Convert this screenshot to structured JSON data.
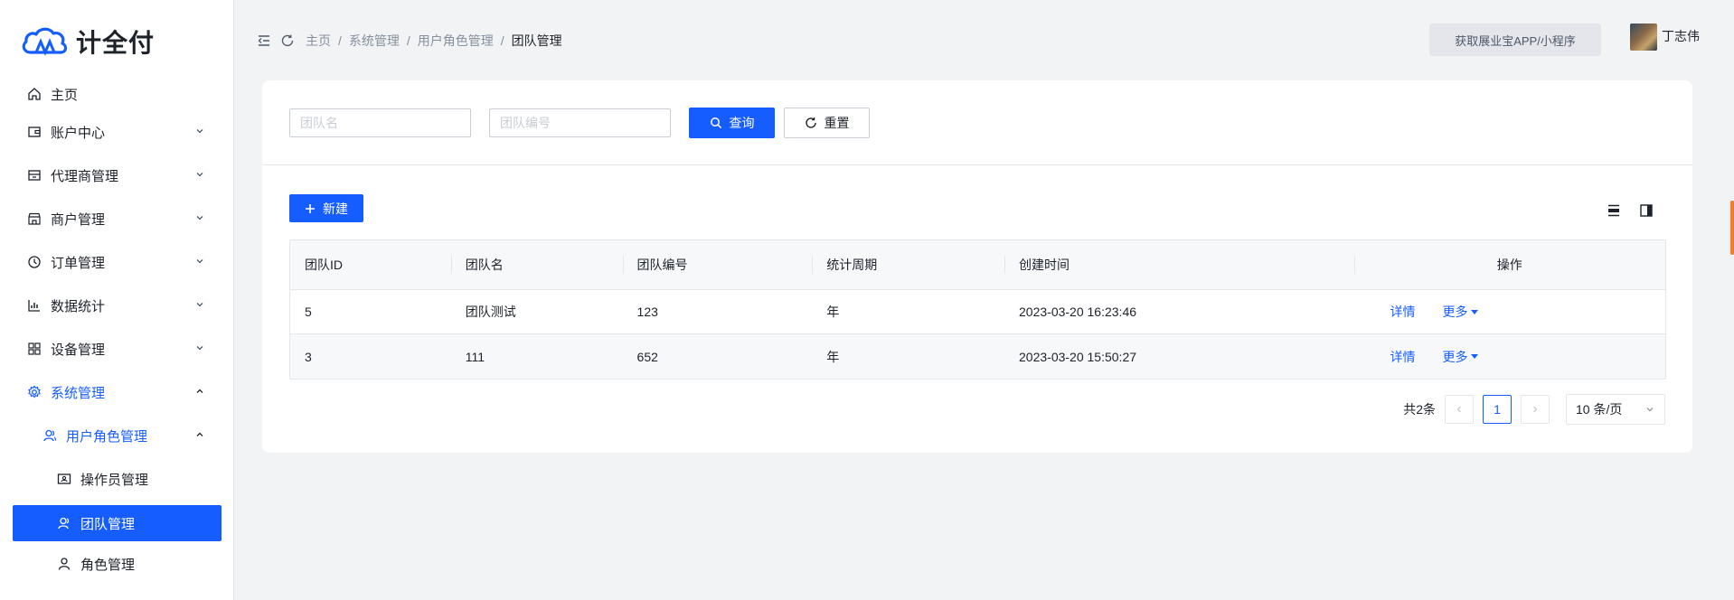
{
  "brand": {
    "name": "计全付",
    "color": "#165dff"
  },
  "sidebar": {
    "items": [
      {
        "label": "主页",
        "icon": "home-icon"
      },
      {
        "label": "账户中心",
        "icon": "wallet-icon",
        "expandable": true
      },
      {
        "label": "代理商管理",
        "icon": "agent-icon",
        "expandable": true
      },
      {
        "label": "商户管理",
        "icon": "store-icon",
        "expandable": true
      },
      {
        "label": "订单管理",
        "icon": "order-icon",
        "expandable": true
      },
      {
        "label": "数据统计",
        "icon": "chart-icon",
        "expandable": true
      },
      {
        "label": "设备管理",
        "icon": "grid-icon",
        "expandable": true
      },
      {
        "label": "系统管理",
        "icon": "gear-icon",
        "expanded": true
      },
      {
        "label": "用户角色管理",
        "icon": "users-icon",
        "expanded": true
      },
      {
        "label": "操作员管理",
        "icon": "id-card-icon"
      },
      {
        "label": "团队管理",
        "icon": "team-icon",
        "selected": true
      },
      {
        "label": "角色管理",
        "icon": "user-icon"
      }
    ]
  },
  "header": {
    "breadcrumb": [
      "主页",
      "系统管理",
      "用户角色管理",
      "团队管理"
    ],
    "separator": "/",
    "app_button": "获取展业宝APP/小程序",
    "user_name": "丁志伟"
  },
  "filters": {
    "team_name_placeholder": "团队名",
    "team_code_placeholder": "团队编号",
    "search_label": "查询",
    "reset_label": "重置"
  },
  "toolbar": {
    "new_label": "新建"
  },
  "table": {
    "columns": [
      "团队ID",
      "团队名",
      "团队编号",
      "统计周期",
      "创建时间",
      "操作"
    ],
    "rows": [
      {
        "id": "5",
        "name": "团队测试",
        "code": "123",
        "period": "年",
        "created": "2023-03-20 16:23:46",
        "detail": "详情",
        "more": "更多"
      },
      {
        "id": "3",
        "name": "111",
        "code": "652",
        "period": "年",
        "created": "2023-03-20 15:50:27",
        "detail": "详情",
        "more": "更多"
      }
    ]
  },
  "pagination": {
    "total": "共2条",
    "current_page": "1",
    "page_size": "10 条/页"
  }
}
